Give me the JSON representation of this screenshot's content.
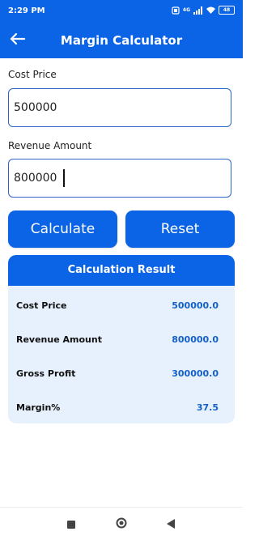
{
  "status": {
    "time": "2:29 PM",
    "battery": "48",
    "network": "4G"
  },
  "app_bar": {
    "title": "Margin Calculator",
    "back_icon": "arrow-left-icon"
  },
  "form": {
    "cost_label": "Cost Price",
    "cost_value": "500000",
    "revenue_label": "Revenue Amount",
    "revenue_value": "800000"
  },
  "buttons": {
    "calculate": "Calculate",
    "reset": "Reset"
  },
  "result": {
    "title": "Calculation Result",
    "rows": [
      {
        "label": "Cost Price",
        "value": "500000.0"
      },
      {
        "label": "Revenue Amount",
        "value": "800000.0"
      },
      {
        "label": "Gross Profit",
        "value": "300000.0"
      },
      {
        "label": "Margin%",
        "value": "37.5"
      }
    ]
  },
  "colors": {
    "primary": "#0b63e5",
    "card_bg": "#e7f0fd",
    "value_text": "#1360c9"
  },
  "nav": {
    "icons": [
      "square-recents-icon",
      "circle-home-icon",
      "triangle-back-icon"
    ]
  }
}
